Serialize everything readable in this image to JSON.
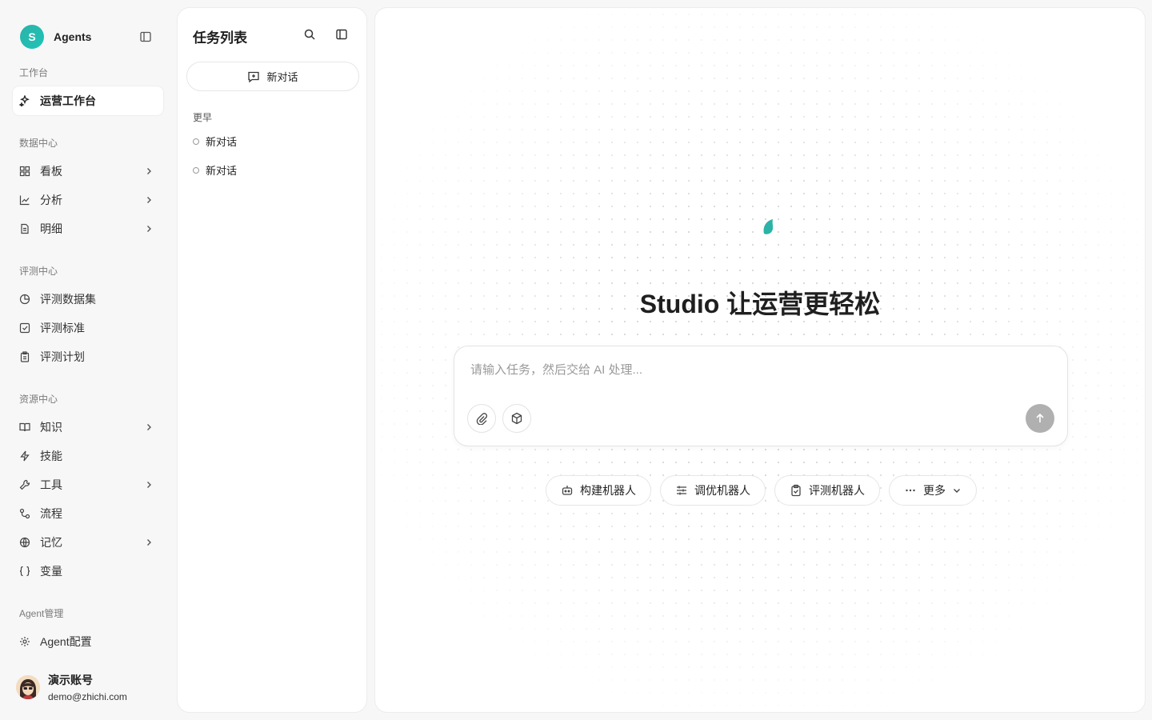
{
  "brand": {
    "initial": "S",
    "name": "Agents"
  },
  "nav": {
    "sections": {
      "workbench": "工作台",
      "data_center": "数据中心",
      "eval_center": "评测中心",
      "resource_center": "资源中心",
      "agent_mgmt": "Agent管理"
    },
    "items": {
      "ops_workbench": "运营工作台",
      "dashboard": "看板",
      "analysis": "分析",
      "details": "明细",
      "eval_dataset": "评测数据集",
      "eval_standard": "评测标准",
      "eval_plan": "评测计划",
      "knowledge": "知识",
      "skills": "技能",
      "tools": "工具",
      "workflow": "流程",
      "memory": "记忆",
      "variables": "变量",
      "agent_config": "Agent配置"
    }
  },
  "user": {
    "name": "演示账号",
    "email": "demo@zhichi.com"
  },
  "tasks": {
    "title": "任务列表",
    "new_chat": "新对话",
    "group": "更早",
    "conversations": [
      "新对话",
      "新对话"
    ]
  },
  "main": {
    "headline": "Studio 让运营更轻松",
    "input_placeholder": "请输入任务，然后交给 AI 处理...",
    "chips": {
      "build": "构建机器人",
      "tune": "调优机器人",
      "eval": "评测机器人",
      "more": "更多"
    }
  },
  "colors": {
    "brand": "#2bb3a7",
    "send_disabled": "#b0b0b0"
  }
}
